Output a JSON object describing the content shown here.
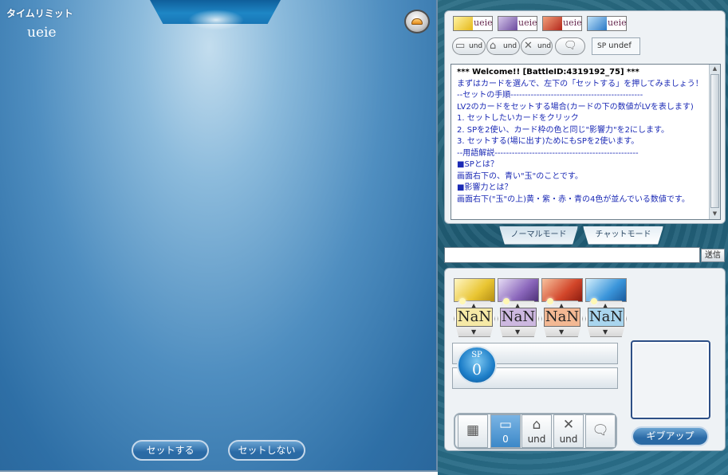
{
  "field": {
    "time_limit_label": "タイムリミット",
    "opponent_name": "ueie",
    "set_button": "セットする",
    "no_set_button": "セットしない"
  },
  "opponent_panel": {
    "mini_cards": [
      {
        "name": "ueie",
        "color": "#f5d33a"
      },
      {
        "name": "ueie",
        "color": "#8a62b8"
      },
      {
        "name": "ueie",
        "color": "#d03a28"
      },
      {
        "name": "ueie",
        "color": "#3c8fd8"
      }
    ],
    "stats": [
      {
        "icon": "card-icon",
        "value": "und"
      },
      {
        "icon": "wall-icon",
        "value": "und"
      },
      {
        "icon": "cross-icon",
        "value": "und"
      }
    ],
    "sp_label": "SP",
    "sp_value": "undef"
  },
  "chat": {
    "lines": [
      "*** Welcome!! [BattleID:4319192_75] ***",
      "まずはカードを選んで、左下の「セットする」を押してみましょう！",
      "--セットの手順----------------------------------------------",
      "LV2のカードをセットする場合(カードの下の数値がLVを表します)",
      "  1. セットしたいカードをクリック",
      "  2. SPを2使い、カード枠の色と同じ\"影響力\"を2にします。",
      "  3. セットする(場に出す)ためにもSPを2使います。",
      "--用語解説--------------------------------------------------",
      "■SPとは？",
      "画面右下の、青い\"玉\"のことです。",
      "■影響力とは？",
      "画面右下(\"玉\"の上)黄・紫・赤・青の4色が並んでいる数値です。"
    ],
    "tab_normal": "ノーマルモード",
    "tab_chat": "チャットモード",
    "input_value": "",
    "send_button": "送信"
  },
  "hand": {
    "cards": [
      {
        "plate": "NaN",
        "color": "#f3dc6a",
        "plate_color": "#f6e9a6"
      },
      {
        "plate": "NaN",
        "color": "#9a7cc6",
        "plate_color": "#cdb8e0"
      },
      {
        "plate": "NaN",
        "color": "#e0743c",
        "plate_color": "#f3b893"
      },
      {
        "plate": "NaN",
        "color": "#4fa6e0",
        "plate_color": "#a9d5ee"
      }
    ],
    "sp_label": "SP",
    "sp_value": "0"
  },
  "toolbar": {
    "grid_icon": "grid-icon",
    "cards_value": "0",
    "wall_value": "und",
    "cross_value": "und",
    "chat_icon": "chat-bubble-icon",
    "give_up": "ギブアップ"
  }
}
